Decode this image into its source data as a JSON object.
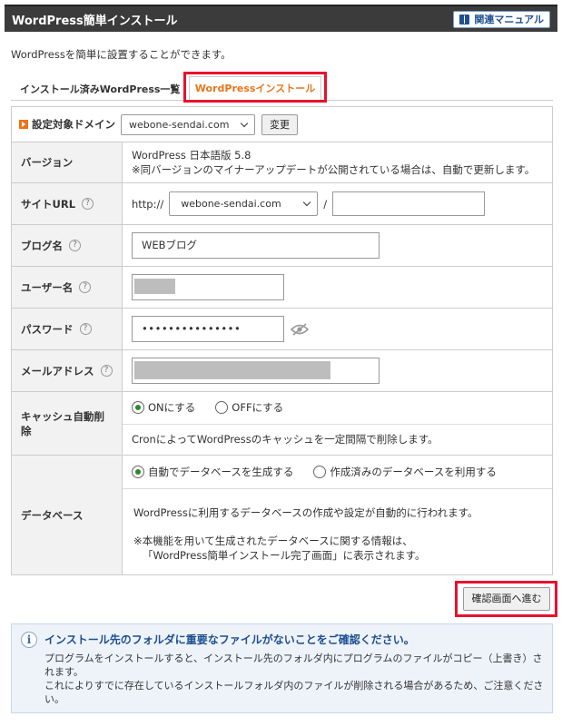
{
  "header": {
    "title": "WordPress簡単インストール",
    "manual_label": "関連マニュアル"
  },
  "intro": "WordPressを簡単に設置することができます。",
  "tabs": [
    {
      "label": "インストール済みWordPress一覧",
      "active": false
    },
    {
      "label": "WordPressインストール",
      "active": true
    }
  ],
  "domain": {
    "label": "設定対象ドメイン",
    "selected": "webone-sendai.com",
    "change_label": "変更"
  },
  "version": {
    "label": "バージョン",
    "value": "WordPress 日本語版 5.8",
    "note": "※同バージョンのマイナーアップデートが公開されている場合は、自動で更新します。"
  },
  "site_url": {
    "label": "サイトURL",
    "prefix": "http://",
    "domain": "webone-sendai.com",
    "separator": "/",
    "path": ""
  },
  "blog_name": {
    "label": "ブログ名",
    "value": "WEBブログ"
  },
  "username": {
    "label": "ユーザー名",
    "value": ""
  },
  "password": {
    "label": "パスワード",
    "value": "•••••••••••••••"
  },
  "email": {
    "label": "メールアドレス",
    "value": ""
  },
  "cache": {
    "label": "キャッシュ自動削除",
    "on_label": "ONにする",
    "off_label": "OFFにする",
    "selected": "on",
    "description": "CronによってWordPressのキャッシュを一定間隔で削除します。"
  },
  "database": {
    "label": "データベース",
    "auto_label": "自動でデータベースを生成する",
    "existing_label": "作成済みのデータベースを利用する",
    "selected": "auto",
    "description": "WordPressに利用するデータベースの作成や設定が自動的に行われます。",
    "note_line1": "※本機能を用いて生成されたデータベースに関する情報は、",
    "note_line2": "「WordPress簡単インストール完了画面」に表示されます。"
  },
  "confirm_label": "確認画面へ進む",
  "notice": {
    "heading": "インストール先のフォルダに重要なファイルがないことをご確認ください。",
    "line1": "プログラムをインストールすると、インストール先のフォルダ内にプログラムのファイルがコピー（上書き）されます。",
    "line2": "これによりすでに存在しているインストールフォルダ内のファイルが削除される場合があるため、ご注意ください。"
  },
  "colors": {
    "accent": "#e8751a",
    "highlight": "#e8112d",
    "header_bg": "#3b3b3b",
    "link_blue": "#1d4f91"
  }
}
